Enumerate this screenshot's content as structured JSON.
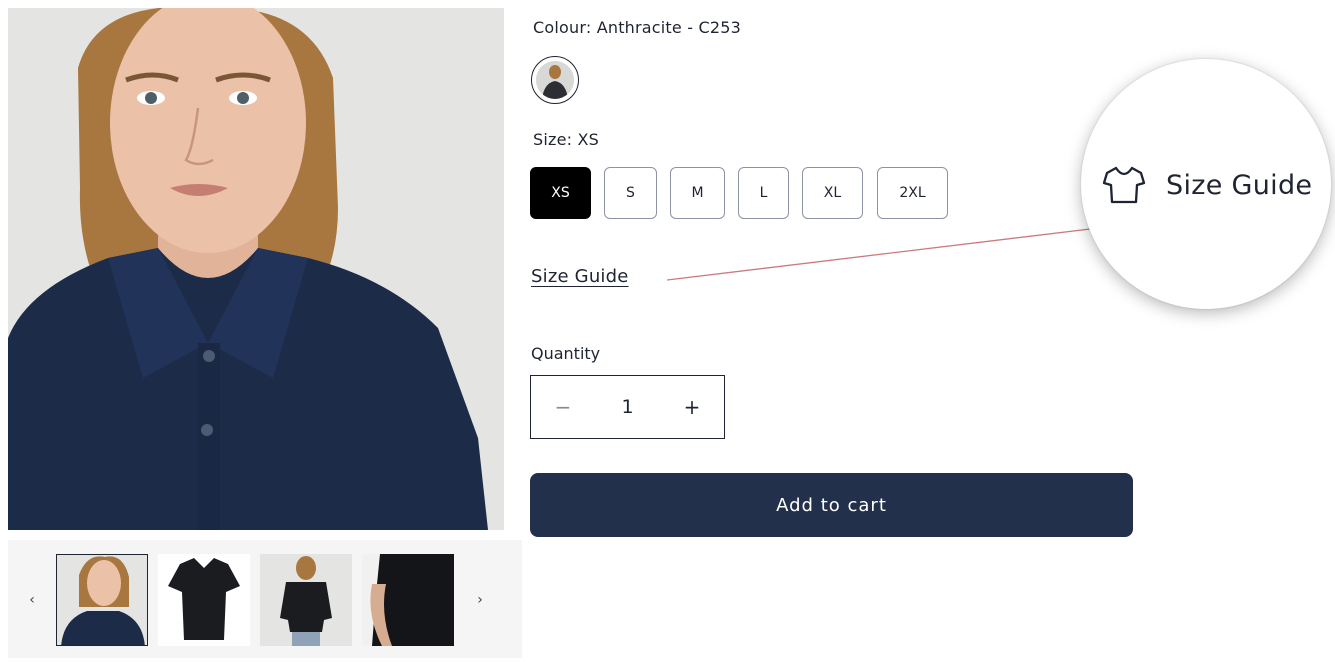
{
  "product": {
    "colour_label": "Colour: Anthracite - C253",
    "size_label": "Size: XS",
    "sizes": [
      {
        "label": "XS",
        "selected": true
      },
      {
        "label": "S",
        "selected": false
      },
      {
        "label": "M",
        "selected": false
      },
      {
        "label": "L",
        "selected": false
      },
      {
        "label": "XL",
        "selected": false
      },
      {
        "label": "2XL",
        "selected": false
      }
    ],
    "size_guide_label": "Size Guide",
    "quantity_label": "Quantity",
    "quantity_value": "1",
    "quantity_decrease_symbol": "−",
    "quantity_increase_symbol": "+",
    "add_to_cart_label": "Add to cart"
  },
  "callout": {
    "label": "Size Guide",
    "icon": "t-shirt-icon",
    "line_color": "#c97b7e"
  },
  "gallery": {
    "prev_arrow": "‹",
    "next_arrow": "›",
    "thumbnails": [
      {
        "name": "model-front",
        "active": true
      },
      {
        "name": "shirt-flat-front",
        "active": false
      },
      {
        "name": "model-back",
        "active": false
      },
      {
        "name": "shirt-detail",
        "active": false
      }
    ]
  },
  "colors": {
    "shirt": "#1c2b48",
    "primary_button": "#23304b",
    "selected_size": "#000000"
  }
}
